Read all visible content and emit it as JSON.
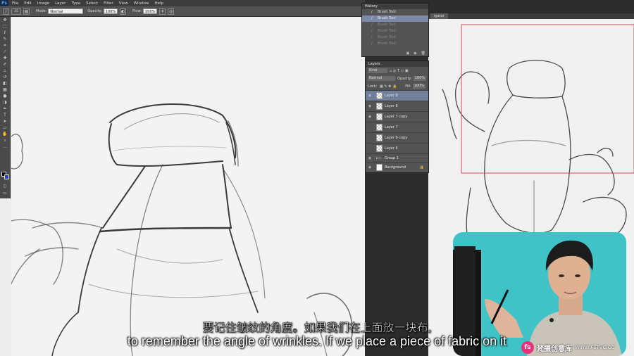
{
  "app": {
    "logo": "Ps"
  },
  "menu": [
    "File",
    "Edit",
    "Image",
    "Layer",
    "Type",
    "Select",
    "Filter",
    "View",
    "Window",
    "Help"
  ],
  "options": {
    "brush_size": "35",
    "mode_label": "Mode:",
    "mode_value": "Normal",
    "opacity_label": "Opacity:",
    "opacity_value": "100%",
    "flow_label": "Flow:",
    "flow_value": "100%"
  },
  "doc2_tab": "igator",
  "history": {
    "title": "History",
    "items": [
      {
        "label": "Brush Tool",
        "state": "normal"
      },
      {
        "label": "Brush Tool",
        "state": "selected"
      },
      {
        "label": "Brush Tool",
        "state": "dim"
      },
      {
        "label": "Brush Tool",
        "state": "dim"
      },
      {
        "label": "Brush Tool",
        "state": "dim"
      },
      {
        "label": "Brush Tool",
        "state": "dim"
      }
    ]
  },
  "layers": {
    "title": "Layers",
    "kind": "Kind",
    "blend": "Normal",
    "opacity_label": "Opacity:",
    "opacity_value": "100%",
    "lock_label": "Lock:",
    "fill_label": "Fill:",
    "fill_value": "100%",
    "items": [
      {
        "name": "Layer 9",
        "type": "layer",
        "selected": true
      },
      {
        "name": "Layer 8",
        "type": "layer",
        "selected": false
      },
      {
        "name": "Layer 7 copy",
        "type": "layer",
        "selected": false
      },
      {
        "name": "Layer 7",
        "type": "layer",
        "selected": false
      },
      {
        "name": "Layer 6 copy",
        "type": "layer",
        "selected": false
      },
      {
        "name": "Layer 6",
        "type": "layer",
        "selected": false
      },
      {
        "name": "Group 1",
        "type": "group",
        "selected": false
      },
      {
        "name": "Background",
        "type": "background",
        "selected": false
      }
    ]
  },
  "subtitle": {
    "cn": "要记住皱纹的角度。如果我们在上面放一块布,",
    "en": "to remember the angle of wrinkles. If we place a piece of fabric on it"
  },
  "watermark": {
    "logo": "fs",
    "name": "梵摄创意库",
    "url": "WWW.FSTVC.CC"
  },
  "colors": {
    "foreground": "#000000",
    "background": "#2840c8",
    "webcam_bg": "#3fc3c7"
  }
}
